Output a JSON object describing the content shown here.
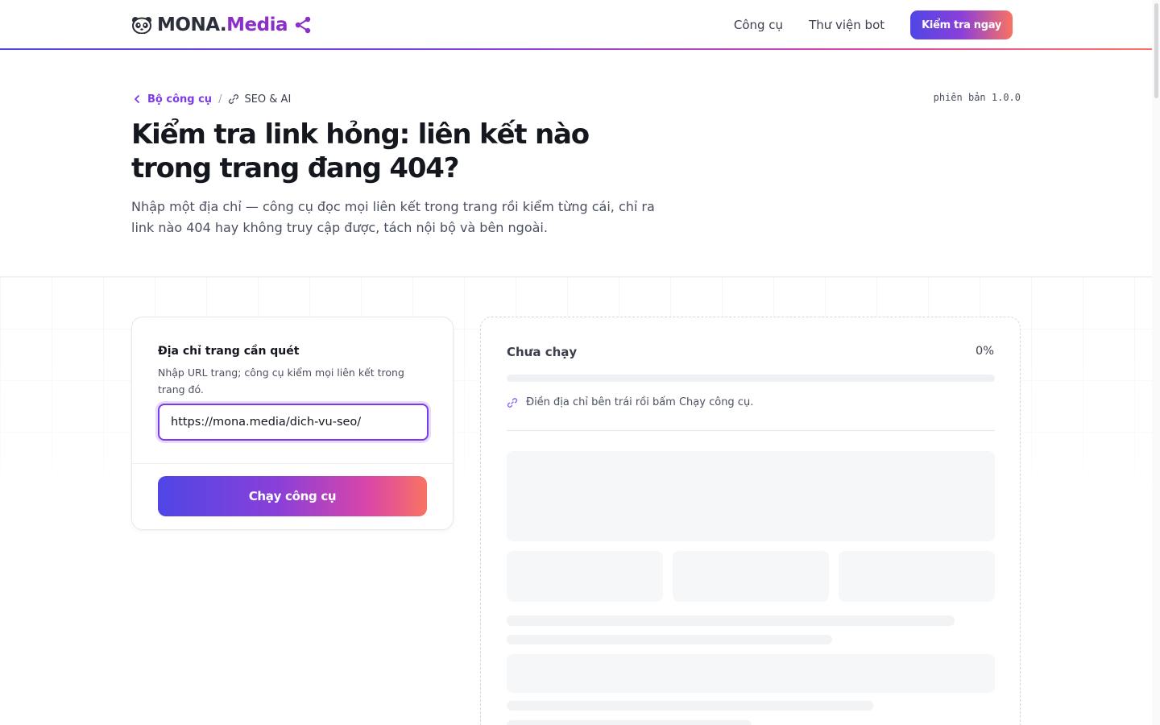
{
  "header": {
    "logo_mona": "MONA.",
    "logo_media": "Media",
    "nav": [
      "Công cụ",
      "Thư viện bot"
    ],
    "cta_label": "Kiểm tra ngay"
  },
  "breadcrumb": {
    "parent": "Bộ công cụ",
    "separator": "/",
    "current": "SEO & AI"
  },
  "version": "phiên bản 1.0.0",
  "hero": {
    "title": "Kiểm tra link hỏng: liên kết nào trong trang đang 404?",
    "subtitle": "Nhập một địa chỉ — công cụ đọc mọi liên kết trong trang rồi kiểm từng cái, chỉ ra link nào 404 hay không truy cập được, tách nội bộ và bên ngoài."
  },
  "form": {
    "label": "Địa chỉ trang cần quét",
    "help": "Nhập URL trang; công cụ kiểm mọi liên kết trong trang đó.",
    "url_value": "https://mona.media/dich-vu-seo/",
    "run_label": "Chạy công cụ"
  },
  "result": {
    "status": "Chưa chạy",
    "percent_label": "0%",
    "progress": 0,
    "hint": "Điền địa chỉ bên trái rồi bấm Chạy công cụ."
  },
  "colors": {
    "accent": "#7c3aed",
    "gradient_start": "#4f46e5",
    "gradient_end": "#f97362"
  },
  "icons": [
    "panda-logo-icon",
    "share-icon",
    "chevron-left-icon",
    "link-icon"
  ]
}
